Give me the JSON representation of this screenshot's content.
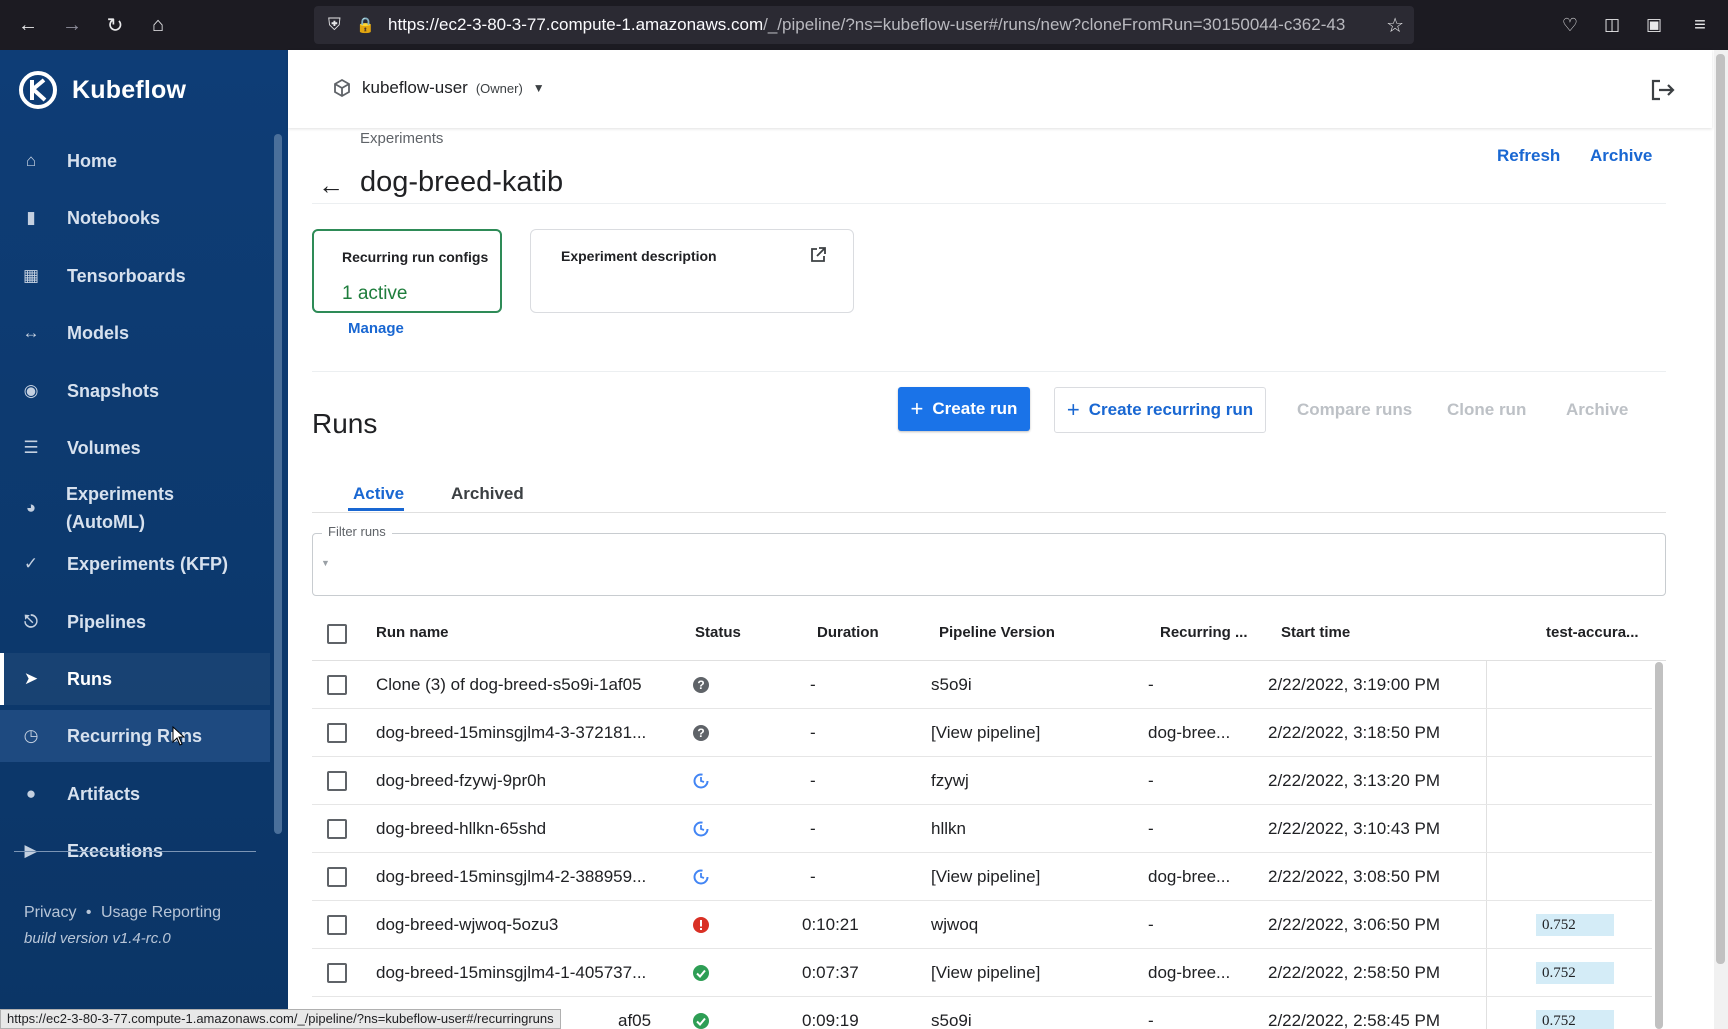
{
  "browser": {
    "url_host": "https://ec2-3-80-3-77.compute-1.amazonaws.com",
    "url_rest": "/_/pipeline/?ns=kubeflow-user#/runs/new?cloneFromRun=30150044-c362-43"
  },
  "sidebar": {
    "brand": "Kubeflow",
    "items": [
      {
        "label": "Home",
        "icon": "home-icon"
      },
      {
        "label": "Notebooks",
        "icon": "book-icon"
      },
      {
        "label": "Tensorboards",
        "icon": "chart-icon"
      },
      {
        "label": "Models",
        "icon": "arrows-icon"
      },
      {
        "label": "Snapshots",
        "icon": "snapshot-icon"
      },
      {
        "label": "Volumes",
        "icon": "list-icon"
      },
      {
        "label": "Experiments (AutoML)",
        "label_line1": "Experiments",
        "label_line2": "(AutoML)",
        "icon": "automl-icon"
      },
      {
        "label": "Experiments (KFP)",
        "icon": "check-icon"
      },
      {
        "label": "Pipelines",
        "icon": "pipeline-icon"
      },
      {
        "label": "Runs",
        "icon": "run-icon"
      },
      {
        "label": "Recurring Runs",
        "icon": "alarm-icon"
      },
      {
        "label": "Artifacts",
        "icon": "bubbles-icon"
      },
      {
        "label": "Executions",
        "icon": "play-icon"
      }
    ],
    "footer": {
      "privacy": "Privacy",
      "separator": "•",
      "usage": "Usage Reporting",
      "build": "build version v1.4-rc.0"
    }
  },
  "header": {
    "namespace": "kubeflow-user",
    "owner": "(Owner)"
  },
  "page": {
    "breadcrumb": "Experiments",
    "title": "dog-breed-katib",
    "refresh": "Refresh",
    "archive": "Archive",
    "card_recurring_title": "Recurring run configs",
    "card_recurring_value": "1 active",
    "manage": "Manage",
    "card_description_title": "Experiment description"
  },
  "runs": {
    "title": "Runs",
    "create_run": "Create run",
    "create_recurring": "Create recurring run",
    "compare": "Compare runs",
    "clone": "Clone run",
    "archive": "Archive",
    "tabs": [
      "Active",
      "Archived"
    ],
    "filter_label": "Filter runs",
    "columns": [
      "Run name",
      "Status",
      "Duration",
      "Pipeline Version",
      "Recurring ...",
      "Start time",
      "test-accura..."
    ],
    "rows": [
      {
        "name": "Clone (3) of dog-breed-s5o9i-1af05",
        "status": "unknown",
        "duration": "-",
        "version": "s5o9i",
        "recurring": "-",
        "start": "2/22/2022, 3:19:00 PM",
        "metric": ""
      },
      {
        "name": "dog-breed-15minsgjlm4-3-372181...",
        "status": "unknown",
        "duration": "-",
        "version": "[View pipeline]",
        "recurring": "dog-bree...",
        "start": "2/22/2022, 3:18:50 PM",
        "metric": ""
      },
      {
        "name": "dog-breed-fzywj-9pr0h",
        "status": "running",
        "duration": "-",
        "version": "fzywj",
        "recurring": "-",
        "start": "2/22/2022, 3:13:20 PM",
        "metric": ""
      },
      {
        "name": "dog-breed-hllkn-65shd",
        "status": "running",
        "duration": "-",
        "version": "hllkn",
        "recurring": "-",
        "start": "2/22/2022, 3:10:43 PM",
        "metric": ""
      },
      {
        "name": "dog-breed-15minsgjlm4-2-388959...",
        "status": "running",
        "duration": "-",
        "version": "[View pipeline]",
        "recurring": "dog-bree...",
        "start": "2/22/2022, 3:08:50 PM",
        "metric": ""
      },
      {
        "name": "dog-breed-wjwoq-5ozu3",
        "status": "error",
        "duration": "0:10:21",
        "version": "wjwoq",
        "recurring": "-",
        "start": "2/22/2022, 3:06:50 PM",
        "metric": "0.752"
      },
      {
        "name": "dog-breed-15minsgjlm4-1-405737...",
        "status": "success",
        "duration": "0:07:37",
        "version": "[View pipeline]",
        "recurring": "dog-bree...",
        "start": "2/22/2022, 2:58:50 PM",
        "metric": "0.752"
      },
      {
        "name": "af05",
        "status": "success",
        "duration": "0:09:19",
        "version": "s5o9i",
        "recurring": "-",
        "start": "2/22/2022, 2:58:45 PM",
        "metric": "0.752"
      }
    ]
  },
  "status_tooltip": "https://ec2-3-80-3-77.compute-1.amazonaws.com/_/pipeline/?ns=kubeflow-user#/recurringruns",
  "colors": {
    "sidebar": "#0e3d76",
    "accent": "#1a73e8",
    "success": "#2e9e55",
    "error": "#d93025",
    "running": "#4285f4"
  }
}
